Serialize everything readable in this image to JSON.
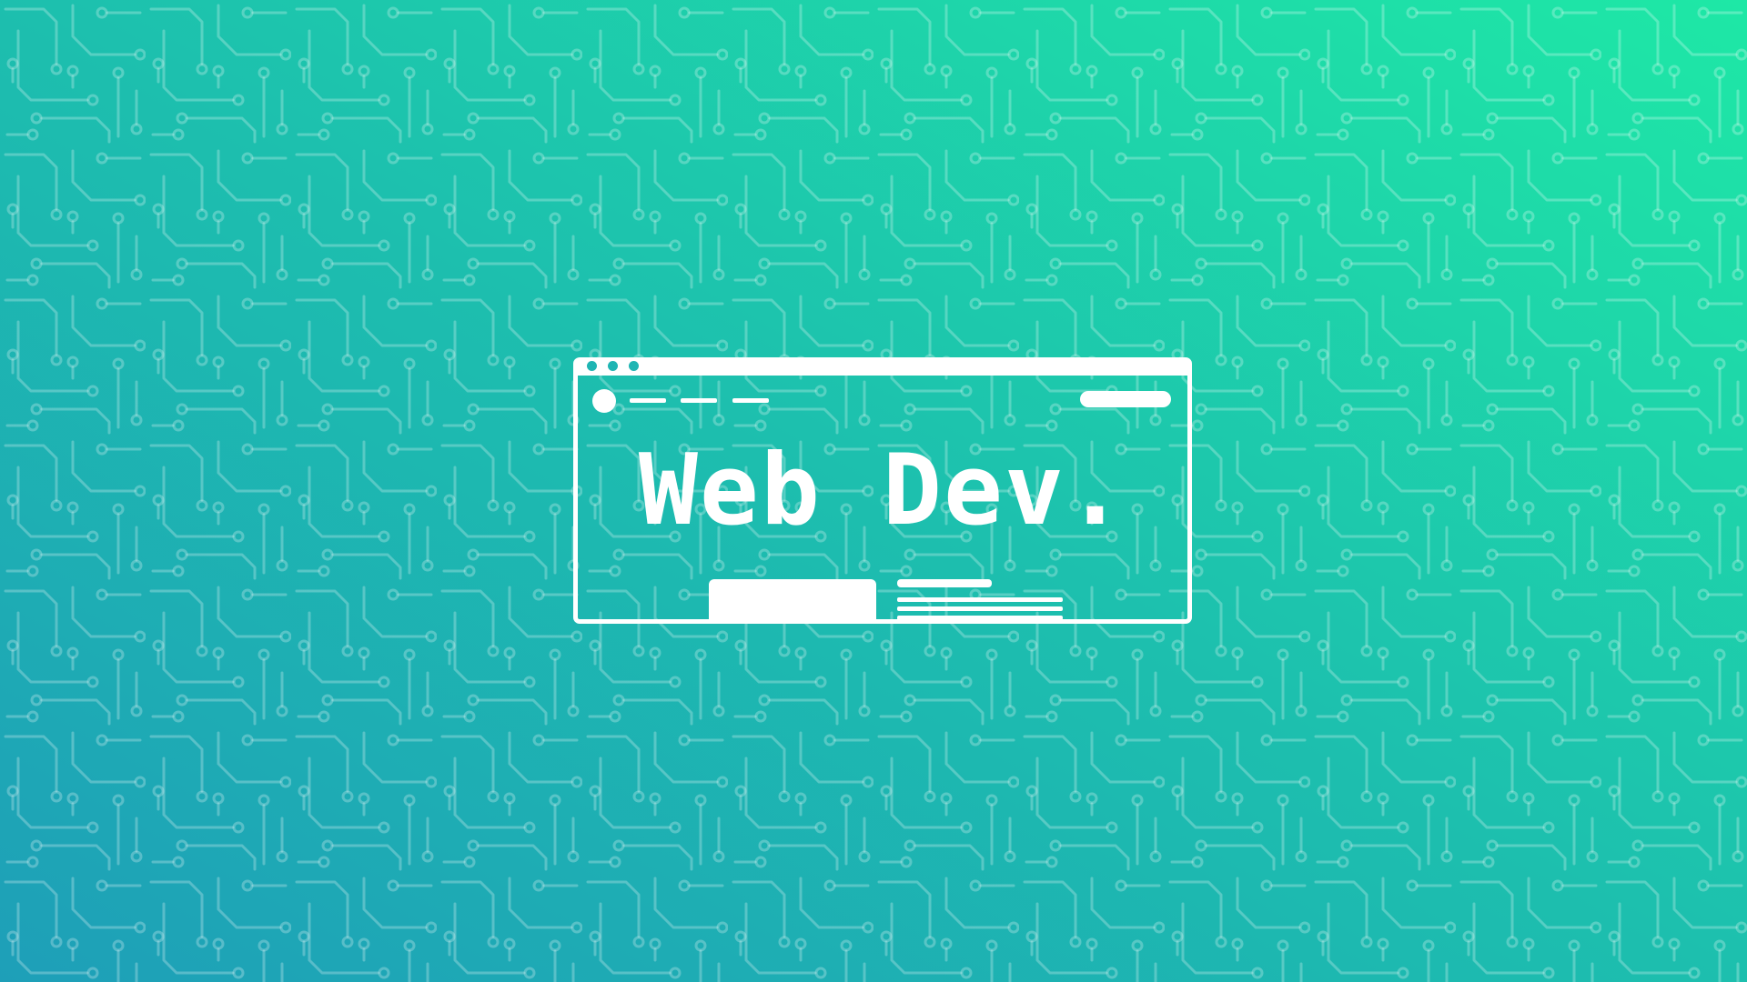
{
  "hero": {
    "title": "Web Dev."
  },
  "colors": {
    "gradient_start": "#1e9fb8",
    "gradient_mid": "#1dbfae",
    "gradient_end": "#1ee8a6",
    "circuit_lines": "#ffffff",
    "foreground": "#ffffff"
  },
  "icons": {
    "window_controls": "three-dots-icon",
    "nav_logo": "circle-logo-icon",
    "background": "circuit-board-pattern"
  }
}
